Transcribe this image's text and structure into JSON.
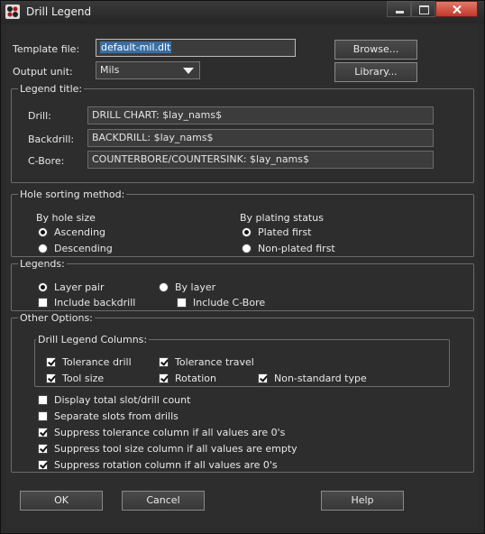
{
  "window": {
    "title": "Drill Legend"
  },
  "template": {
    "label": "Template file:",
    "value": "default-mil.dlt",
    "browse": "Browse..."
  },
  "output": {
    "label": "Output unit:",
    "value": "Mils",
    "library": "Library..."
  },
  "legend_title": {
    "group": "Legend title:",
    "drill_label": "Drill:",
    "drill_value": "DRILL CHART: $lay_nams$",
    "backdrill_label": "Backdrill:",
    "backdrill_value": "BACKDRILL: $lay_nams$",
    "cbore_label": "C-Bore:",
    "cbore_value": "COUNTERBORE/COUNTERSINK: $lay_nams$"
  },
  "sorting": {
    "group": "Hole sorting method:",
    "by_size": "By hole size",
    "ascending": "Ascending",
    "descending": "Descending",
    "by_plating": "By plating status",
    "plated_first": "Plated first",
    "nonplated_first": "Non-plated first"
  },
  "legends": {
    "group": "Legends:",
    "layer_pair": "Layer pair",
    "by_layer": "By layer",
    "include_backdrill": "Include backdrill",
    "include_cbore": "Include C-Bore"
  },
  "other": {
    "group": "Other Options:",
    "columns_group": "Drill Legend Columns:",
    "tolerance_drill": "Tolerance drill",
    "tolerance_travel": "Tolerance travel",
    "tool_size": "Tool size",
    "rotation": "Rotation",
    "non_standard": "Non-standard type",
    "display_total": "Display total slot/drill count",
    "separate_slots": "Separate slots from drills",
    "suppress_tolerance": "Suppress tolerance column if all values are 0's",
    "suppress_tool_size": "Suppress tool size column if all values are empty",
    "suppress_rotation": "Suppress rotation column if all values are 0's"
  },
  "footer": {
    "ok": "OK",
    "cancel": "Cancel",
    "help": "Help"
  }
}
